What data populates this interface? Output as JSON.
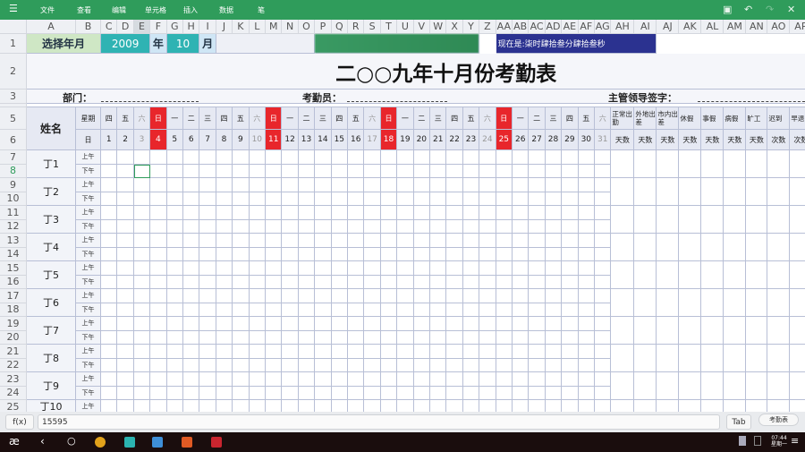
{
  "toolbar": {
    "menus": [
      "文件",
      "查看",
      "编辑",
      "单元格",
      "插入",
      "数据",
      "笔"
    ],
    "icons": [
      "save-icon",
      "undo-icon",
      "redo-icon",
      "close-icon"
    ]
  },
  "columns": [
    "A",
    "B",
    "C",
    "D",
    "E",
    "F",
    "G",
    "H",
    "I",
    "J",
    "K",
    "L",
    "M",
    "N",
    "O",
    "P",
    "Q",
    "R",
    "S",
    "T",
    "U",
    "V",
    "W",
    "X",
    "Y",
    "Z",
    "AA",
    "AB",
    "AC",
    "AD",
    "AE",
    "AF",
    "AG",
    "AH",
    "AI",
    "AJ",
    "AK",
    "AL",
    "AM",
    "AN",
    "AO",
    "AP"
  ],
  "rows": [
    "1",
    "2",
    "3",
    "",
    "5",
    "6",
    "7",
    "8",
    "9",
    "10",
    "11",
    "12",
    "13",
    "14",
    "15",
    "16",
    "17",
    "18",
    "19",
    "20",
    "21",
    "22",
    "23",
    "24",
    "25"
  ],
  "selected_cell": "E8",
  "row1": {
    "select_label": "选择年月",
    "year": "2009",
    "year_unit": "年",
    "month": "10",
    "month_unit": "月",
    "clock": "现在是:柒时肆拾叁分肆拾叁秒"
  },
  "title": "二○○九年十月份考勤表",
  "row3": {
    "dept": "部门：",
    "clerk": "考勤员：",
    "supervisor": "主管领导签字："
  },
  "header": {
    "name": "姓名",
    "weekday_label": "星期",
    "day_label": "日"
  },
  "weekdays": [
    "四",
    "五",
    "六",
    "日",
    "一",
    "二",
    "三",
    "四",
    "五",
    "六",
    "日",
    "一",
    "二",
    "三",
    "四",
    "五",
    "六",
    "日",
    "一",
    "二",
    "三",
    "四",
    "五",
    "六",
    "日",
    "一",
    "二",
    "三",
    "四",
    "五",
    "六"
  ],
  "days": [
    "1",
    "2",
    "3",
    "4",
    "5",
    "6",
    "7",
    "8",
    "9",
    "10",
    "11",
    "12",
    "13",
    "14",
    "15",
    "16",
    "17",
    "18",
    "19",
    "20",
    "21",
    "22",
    "23",
    "24",
    "25",
    "26",
    "27",
    "28",
    "29",
    "30",
    "31"
  ],
  "summary": [
    {
      "label": "正常出勤",
      "unit": "天数"
    },
    {
      "label": "外地出差",
      "unit": "天数"
    },
    {
      "label": "市内出差",
      "unit": "天数"
    },
    {
      "label": "休假",
      "unit": "天数"
    },
    {
      "label": "事假",
      "unit": "天数"
    },
    {
      "label": "病假",
      "unit": "天数"
    },
    {
      "label": "旷工",
      "unit": "天数"
    },
    {
      "label": "迟到",
      "unit": "次数"
    },
    {
      "label": "早退",
      "unit": "次数"
    }
  ],
  "employees": [
    "丁1",
    "丁2",
    "丁3",
    "丁4",
    "丁5",
    "丁6",
    "丁7",
    "丁8",
    "丁9",
    "丁10"
  ],
  "periods": [
    "上午",
    "下午"
  ],
  "formula": {
    "fx": "f(x)",
    "value": "15595",
    "tab": "Tab",
    "sheet_tab": "考勤表"
  },
  "taskbar": {
    "time": "07:44",
    "day": "星期一"
  },
  "colors": {
    "toolbar": "#2f9c5b",
    "sunday": "#e8262b",
    "teal": "#2fb3b3",
    "navy": "#2b3290",
    "label_green": "#cfe7c5",
    "light_blue": "#cfe6f5"
  }
}
